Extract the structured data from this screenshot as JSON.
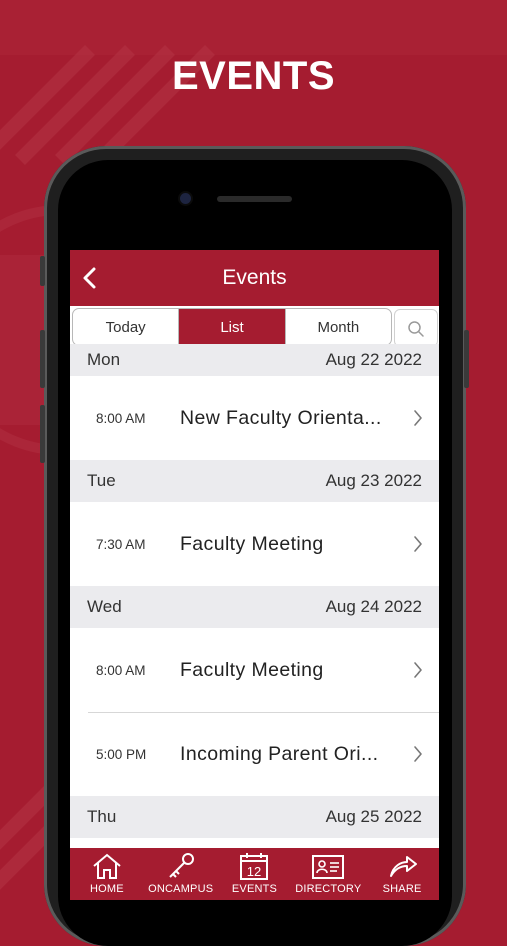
{
  "promo": {
    "title": "EVENTS"
  },
  "nav": {
    "title": "Events"
  },
  "segments": {
    "today": "Today",
    "list": "List",
    "month": "Month"
  },
  "days": [
    {
      "weekday": "Mon",
      "date": "Aug 22 2022",
      "events": [
        {
          "time": "8:00 AM",
          "name": "New Faculty Orienta..."
        }
      ]
    },
    {
      "weekday": "Tue",
      "date": "Aug 23 2022",
      "events": [
        {
          "time": "7:30 AM",
          "name": "Faculty Meeting"
        }
      ]
    },
    {
      "weekday": "Wed",
      "date": "Aug 24 2022",
      "events": [
        {
          "time": "8:00 AM",
          "name": "Faculty Meeting"
        },
        {
          "time": "5:00 PM",
          "name": "Incoming Parent Ori..."
        }
      ]
    },
    {
      "weekday": "Thu",
      "date": "Aug 25 2022",
      "events": []
    }
  ],
  "tabs": [
    {
      "label": "HOME",
      "icon": "home-icon"
    },
    {
      "label": "ONCAMPUS",
      "icon": "key-icon"
    },
    {
      "label": "EVENTS",
      "icon": "calendar-icon",
      "badge": "12"
    },
    {
      "label": "DIRECTORY",
      "icon": "directory-card-icon"
    },
    {
      "label": "SHARE",
      "icon": "share-icon"
    }
  ],
  "colors": {
    "brand": "#a51c30",
    "header_bg": "#ebebee"
  }
}
